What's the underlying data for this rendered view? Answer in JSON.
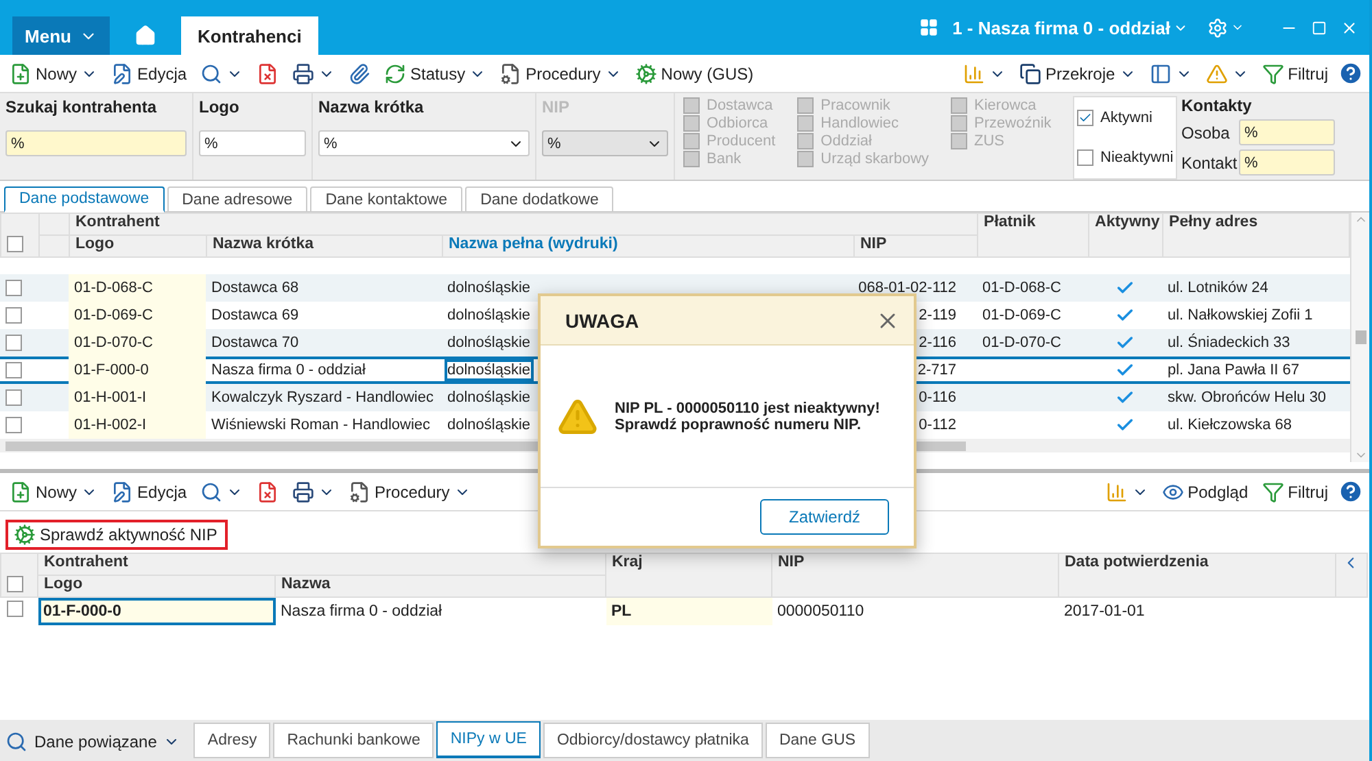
{
  "titlebar": {
    "menu": "Menu",
    "tabs": [
      {
        "label": "Kontrahenci",
        "selected": true
      }
    ],
    "company": "1 - Nasza firma 0 - oddział"
  },
  "toolbar": {
    "left": [
      {
        "label": "Nowy",
        "dropdown": true
      },
      {
        "label": "Edycja",
        "dropdown": false
      },
      {
        "dropdown": true
      },
      {
        "dropdown": false
      },
      {
        "dropdown": true
      },
      {
        "dropdown": false
      },
      {
        "label": "Statusy",
        "dropdown": true
      },
      {
        "label": "Procedury",
        "dropdown": true
      },
      {
        "label": "Nowy (GUS)",
        "dropdown": false
      }
    ],
    "right": [
      {
        "dropdown": true
      },
      {
        "label": "Przekroje",
        "dropdown": true
      },
      {
        "dropdown": true
      },
      {
        "dropdown": true
      },
      {
        "label": "Filtruj",
        "dropdown": false
      }
    ]
  },
  "filters": {
    "search": {
      "label": "Szukaj kontrahenta",
      "value": "%"
    },
    "logo": {
      "label": "Logo",
      "value": "%"
    },
    "short_name": {
      "label": "Nazwa krótka",
      "value": "%"
    },
    "nip": {
      "label": "NIP",
      "value": "%",
      "disabled": true
    },
    "types": [
      [
        {
          "label": "Dostawca",
          "checked": false,
          "disabled": true
        },
        {
          "label": "Odbiorca",
          "checked": false,
          "disabled": true
        },
        {
          "label": "Producent",
          "checked": false,
          "disabled": true
        },
        {
          "label": "Bank",
          "checked": false,
          "disabled": true
        }
      ],
      [
        {
          "label": "Pracownik",
          "checked": false,
          "disabled": true
        },
        {
          "label": "Handlowiec",
          "checked": false,
          "disabled": true
        },
        {
          "label": "Oddział",
          "checked": false,
          "disabled": true
        },
        {
          "label": "Urząd skarbowy",
          "checked": false,
          "disabled": true
        }
      ],
      [
        {
          "label": "Kierowca",
          "checked": false,
          "disabled": true
        },
        {
          "label": "Przewoźnik",
          "checked": false,
          "disabled": true
        },
        {
          "label": "ZUS",
          "checked": false,
          "disabled": true
        }
      ]
    ],
    "status": [
      {
        "label": "Aktywni",
        "checked": true
      },
      {
        "label": "Nieaktywni",
        "checked": false
      }
    ],
    "contacts": {
      "title": "Kontakty",
      "fields": [
        {
          "label": "Osoba",
          "value": "%"
        },
        {
          "label": "Kontakt",
          "value": "%"
        }
      ]
    }
  },
  "tabs": [
    {
      "label": "Dane podstawowe",
      "selected": true
    },
    {
      "label": "Dane adresowe",
      "selected": false
    },
    {
      "label": "Dane kontaktowe",
      "selected": false
    },
    {
      "label": "Dane dodatkowe",
      "selected": false
    }
  ],
  "grid": {
    "group": "Kontrahent",
    "all_checked": false,
    "columns": [
      {
        "label": "Logo",
        "sorted": false
      },
      {
        "label": "Nazwa krótka",
        "sorted": false
      },
      {
        "label": "Nazwa pełna (wydruki)",
        "sorted": true
      },
      {
        "label": "NIP",
        "sorted": false
      },
      {
        "label": "Płatnik",
        "sorted": false
      },
      {
        "label": "Aktywny",
        "sorted": false
      },
      {
        "label": "Pełny adres",
        "sorted": false
      }
    ],
    "rows": [
      {
        "logo": "01-D-068-C",
        "name": "Dostawca 68",
        "full_name": "dolnośląskie",
        "nip": "068-01-02-112",
        "payer": "01-D-068-C",
        "active": true,
        "address": "ul. Lotników 24",
        "selected": false,
        "checked": false
      },
      {
        "logo": "01-D-069-C",
        "name": "Dostawca 69",
        "full_name": "dolnośląskie",
        "nip": "2-119",
        "payer": "01-D-069-C",
        "active": true,
        "address": "ul. Nałkowskiej Zofii 1",
        "selected": false,
        "checked": false
      },
      {
        "logo": "01-D-070-C",
        "name": "Dostawca 70",
        "full_name": "dolnośląskie",
        "nip": "2-116",
        "payer": "01-D-070-C",
        "active": true,
        "address": "ul. Śniadeckich 33",
        "selected": false,
        "checked": false
      },
      {
        "logo": "01-F-000-0",
        "name": "Nasza firma 0 - oddział",
        "full_name": "dolnośląskie",
        "nip": "2-717",
        "payer": "",
        "active": true,
        "address": "pl. Jana Pawła II 67",
        "selected": true,
        "checked": false
      },
      {
        "logo": "01-H-001-I",
        "name": "Kowalczyk Ryszard - Handlowiec",
        "full_name": "dolnośląskie",
        "nip": "0-116",
        "payer": "",
        "active": true,
        "address": "skw. Obrońców Helu 30",
        "selected": false,
        "checked": false
      },
      {
        "logo": "01-H-002-I",
        "name": "Wiśniewski Roman - Handlowiec",
        "full_name": "dolnośląskie",
        "nip": "0-112",
        "payer": "",
        "active": true,
        "address": "ul. Kiełczowska 68",
        "selected": false,
        "checked": false
      }
    ]
  },
  "sub_toolbar": {
    "left": [
      {
        "label": "Nowy",
        "dropdown": true
      },
      {
        "label": "Edycja",
        "dropdown": false
      },
      {
        "dropdown": true
      },
      {
        "dropdown": false
      },
      {
        "dropdown": true
      },
      {
        "label": "Procedury",
        "dropdown": true
      }
    ],
    "right": [
      {
        "dropdown": true
      },
      {
        "label": "Podgląd",
        "dropdown": false
      },
      {
        "label": "Filtruj",
        "dropdown": false
      }
    ],
    "action": "Sprawdź aktywność NIP"
  },
  "sub_grid": {
    "group": "Kontrahent",
    "all_checked": false,
    "columns": [
      "Logo",
      "Nazwa",
      "Kraj",
      "NIP",
      "Data potwierdzenia"
    ],
    "rows": [
      {
        "logo": "01-F-000-0",
        "name": "Nasza firma 0 - oddział",
        "country": "PL",
        "nip": "0000050110",
        "date": "2017-01-01",
        "checked": false
      }
    ]
  },
  "bottom_tabs": {
    "related": "Dane powiązane",
    "tabs": [
      {
        "label": "Adresy",
        "selected": false
      },
      {
        "label": "Rachunki bankowe",
        "selected": false
      },
      {
        "label": "NIPy w UE",
        "selected": true
      },
      {
        "label": "Odbiorcy/dostawcy płatnika",
        "selected": false
      },
      {
        "label": "Dane GUS",
        "selected": false
      }
    ]
  },
  "dialog": {
    "title": "UWAGA",
    "message": [
      "NIP PL - 0000050110 jest nieaktywny!",
      "Sprawdź poprawność numeru NIP."
    ],
    "button": "Zatwierdź"
  }
}
